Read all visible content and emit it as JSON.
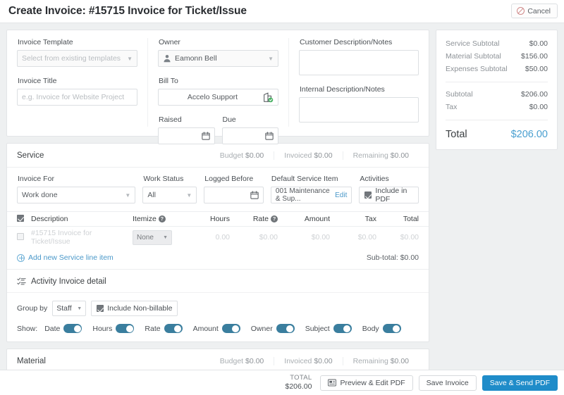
{
  "header": {
    "title": "Create Invoice: #15715 Invoice for Ticket/Issue",
    "cancel_label": "Cancel",
    "cancel_icon": "ban-icon"
  },
  "invoice_form": {
    "template": {
      "label": "Invoice Template",
      "value": "",
      "placeholder": "Select from existing templates"
    },
    "title_field": {
      "label": "Invoice Title",
      "value": "",
      "placeholder": "e.g. Invoice for Website Project"
    },
    "owner": {
      "label": "Owner",
      "value": "Eamonn Bell",
      "icon": "user-avatar-icon"
    },
    "bill_to": {
      "label": "Bill To",
      "value": "Accelo Support",
      "icon": "company-verified-icon"
    },
    "raised": {
      "label": "Raised",
      "value": "",
      "icon": "calendar-icon"
    },
    "due": {
      "label": "Due",
      "value": "",
      "icon": "calendar-icon"
    },
    "customer_notes": {
      "label": "Customer Description/Notes",
      "value": ""
    },
    "internal_notes": {
      "label": "Internal Description/Notes",
      "value": ""
    }
  },
  "totals_panel": {
    "rows": [
      {
        "label": "Service Subtotal",
        "value": "$0.00"
      },
      {
        "label": "Material Subtotal",
        "value": "$156.00"
      },
      {
        "label": "Expenses Subtotal",
        "value": "$50.00"
      }
    ],
    "subtotal": {
      "label": "Subtotal",
      "value": "$206.00"
    },
    "tax": {
      "label": "Tax",
      "value": "$0.00"
    },
    "total": {
      "label": "Total",
      "value": "$206.00"
    },
    "total_color": "#4a9fd0"
  },
  "service_section": {
    "title": "Service",
    "stats": [
      {
        "label": "Budget",
        "value": "$0.00"
      },
      {
        "label": "Invoiced",
        "value": "$0.00"
      },
      {
        "label": "Remaining",
        "value": "$0.00"
      }
    ],
    "filters": {
      "invoice_for": {
        "label": "Invoice For",
        "value": "Work done"
      },
      "work_status": {
        "label": "Work Status",
        "value": "All"
      },
      "logged_before": {
        "label": "Logged Before",
        "value": "",
        "icon": "calendar-icon"
      },
      "default_service_item": {
        "label": "Default Service Item",
        "value": "001 Maintenance & Sup...",
        "edit_label": "Edit"
      },
      "activities": {
        "label": "Activities",
        "checkbox_label": "Include in PDF",
        "checked": true
      }
    },
    "table": {
      "select_all_checked": true,
      "columns": [
        "Description",
        "Itemize",
        "Hours",
        "Rate",
        "Amount",
        "Tax",
        "Total"
      ],
      "help_columns": [
        "Itemize",
        "Rate"
      ],
      "rows": [
        {
          "checked": false,
          "description": "#15715 Invoice for Ticket/Issue",
          "itemize": "None",
          "hours": "0.00",
          "rate": "$0.00",
          "amount": "$0.00",
          "tax": "$0.00",
          "total": "$0.00"
        }
      ],
      "add_row_label": "Add new Service line item",
      "subtotal_label": "Sub-total:",
      "subtotal_value": "$0.00"
    },
    "activity_detail": {
      "title": "Activity Invoice detail",
      "icon": "checklist-icon",
      "group_by_label": "Group by",
      "group_by_value": "Staff",
      "include_nonbillable_label": "Include Non-billable",
      "include_nonbillable_checked": true,
      "show_label": "Show:",
      "toggles": [
        {
          "label": "Date",
          "on": true
        },
        {
          "label": "Hours",
          "on": true
        },
        {
          "label": "Rate",
          "on": true
        },
        {
          "label": "Amount",
          "on": true
        },
        {
          "label": "Owner",
          "on": true
        },
        {
          "label": "Subject",
          "on": true
        },
        {
          "label": "Body",
          "on": true
        }
      ],
      "toggle_color": "#3a7e9e"
    }
  },
  "material_section": {
    "title": "Material",
    "stats": [
      {
        "label": "Budget",
        "value": "$0.00"
      },
      {
        "label": "Invoiced",
        "value": "$0.00"
      },
      {
        "label": "Remaining",
        "value": "$0.00"
      }
    ]
  },
  "footer": {
    "total_label": "TOTAL",
    "total_value": "$206.00",
    "preview_label": "Preview & Edit PDF",
    "preview_icon": "pdf-icon",
    "save_label": "Save Invoice",
    "send_label": "Save & Send PDF",
    "primary_color": "#1f8cc9"
  }
}
